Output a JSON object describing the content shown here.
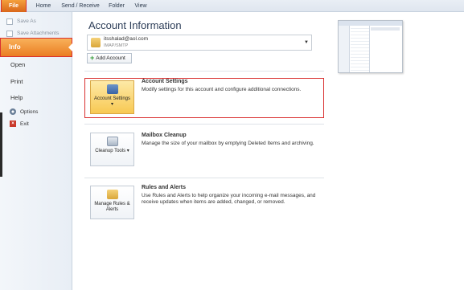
{
  "ribbon": {
    "tabs": [
      "File",
      "Home",
      "Send / Receive",
      "Folder",
      "View"
    ]
  },
  "nav": {
    "save_as": "Save As",
    "save_attachments": "Save Attachments",
    "info": "Info",
    "open": "Open",
    "print": "Print",
    "help": "Help",
    "options": "Options",
    "exit": "Exit"
  },
  "main": {
    "title": "Account Information",
    "account": {
      "email": "itsshalad@aol.com",
      "type": "IMAP/SMTP"
    },
    "add_account_label": "Add Account",
    "sections": [
      {
        "button_label": "Account Settings ▾",
        "title": "Account Settings",
        "description": "Modify settings for this account and configure additional connections."
      },
      {
        "button_label": "Cleanup Tools ▾",
        "title": "Mailbox Cleanup",
        "description": "Manage the size of your mailbox by emptying Deleted Items and archiving."
      },
      {
        "button_label": "Manage Rules & Alerts",
        "title": "Rules and Alerts",
        "description": "Use Rules and Alerts to help organize your incoming e-mail messages, and receive updates when items are added, changed, or removed."
      }
    ]
  },
  "colors": {
    "highlight_border": "#d93030",
    "selected_nav": "#ea7d22"
  }
}
